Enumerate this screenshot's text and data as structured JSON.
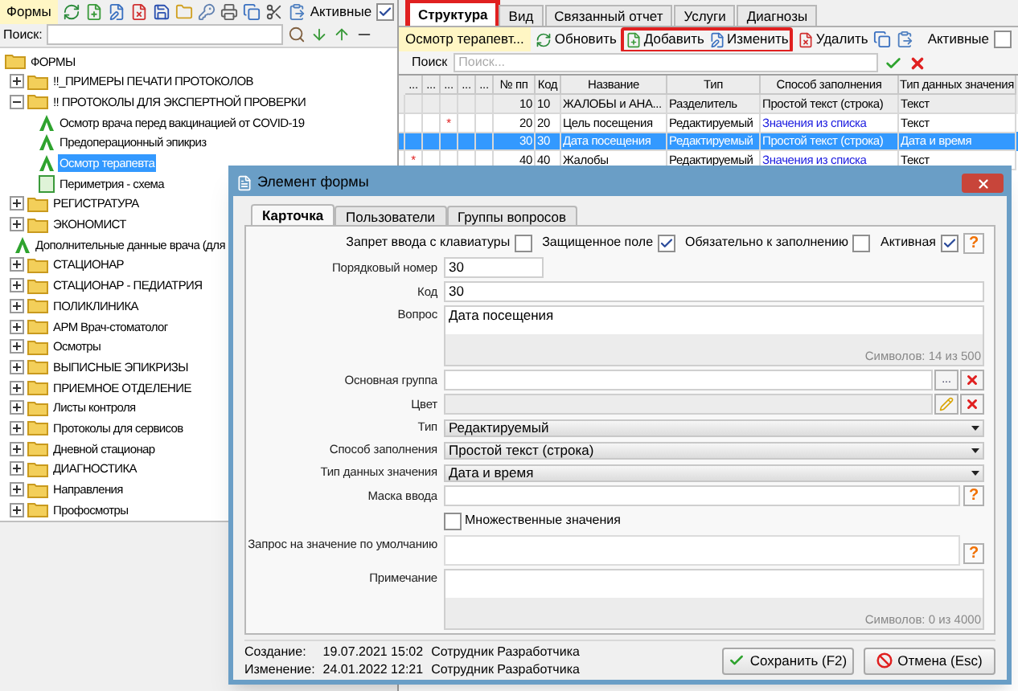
{
  "left_panel": {
    "title": "Формы",
    "active_label": "Активные",
    "active_checked": true,
    "search_label": "Поиск:",
    "tree": [
      {
        "label": "ФОРМЫ",
        "kind": "root",
        "selected": false,
        "children": [
          {
            "label": "!!_ПРИМЕРЫ ПЕЧАТИ ПРОТОКОЛОВ",
            "kind": "folder",
            "expanded": false,
            "selected": false
          },
          {
            "label": "!! ПРОТОКОЛЫ ДЛЯ ЭКСПЕРТНОЙ ПРОВЕРКИ",
            "kind": "folder",
            "expanded": true,
            "selected": false,
            "children": [
              {
                "label": "Осмотр врача перед вакцинацией от COVID-19",
                "kind": "form",
                "selected": false
              },
              {
                "label": "Предоперационный эпикриз",
                "kind": "form",
                "selected": false
              },
              {
                "label": "Осмотр терапевта",
                "kind": "form",
                "selected": true
              },
              {
                "label": "Периметрия - схема",
                "kind": "scheme",
                "selected": false
              }
            ]
          },
          {
            "label": "РЕГИСТРАТУРА",
            "kind": "folder",
            "expanded": false,
            "selected": false
          },
          {
            "label": "ЭКОНОМИСТ",
            "kind": "folder",
            "expanded": false,
            "selected": false
          },
          {
            "label": "Дополнительные данные врача (для",
            "kind": "form",
            "selected": false
          },
          {
            "label": "СТАЦИОНАР",
            "kind": "folder",
            "expanded": false,
            "selected": false
          },
          {
            "label": "СТАЦИОНАР - ПЕДИАТРИЯ",
            "kind": "folder",
            "expanded": false,
            "selected": false
          },
          {
            "label": "ПОЛИКЛИНИКА",
            "kind": "folder",
            "expanded": false,
            "selected": false
          },
          {
            "label": "АРМ Врач-стоматолог",
            "kind": "folder",
            "expanded": false,
            "selected": false
          },
          {
            "label": "Осмотры",
            "kind": "folder",
            "expanded": false,
            "selected": false
          },
          {
            "label": "ВЫПИСНЫЕ ЭПИКРИЗЫ",
            "kind": "folder",
            "expanded": false,
            "selected": false
          },
          {
            "label": "ПРИЕМНОЕ ОТДЕЛЕНИЕ",
            "kind": "folder",
            "expanded": false,
            "selected": false
          },
          {
            "label": "Листы контроля",
            "kind": "folder",
            "expanded": false,
            "selected": false
          },
          {
            "label": "Протоколы для сервисов",
            "kind": "folder",
            "expanded": false,
            "selected": false
          },
          {
            "label": "Дневной стационар",
            "kind": "folder",
            "expanded": false,
            "selected": false
          },
          {
            "label": "ДИАГНОСТИКА",
            "kind": "folder",
            "expanded": false,
            "selected": false
          },
          {
            "label": "Направления",
            "kind": "folder",
            "expanded": false,
            "selected": false
          },
          {
            "label": "Профосмотры",
            "kind": "folder",
            "expanded": false,
            "selected": false
          }
        ]
      }
    ]
  },
  "right_panel": {
    "tabs": [
      {
        "label": "Структура",
        "selected": true
      },
      {
        "label": "Вид",
        "selected": false
      },
      {
        "label": "Связанный отчет",
        "selected": false
      },
      {
        "label": "Услуги",
        "selected": false
      },
      {
        "label": "Диагнозы",
        "selected": false
      }
    ],
    "form_name": "Осмотр терапевт...",
    "refresh": "Обновить",
    "add": "Добавить",
    "edit": "Изменить",
    "delete": "Удалить",
    "active_label": "Активные",
    "active_checked": false,
    "search_label": "Поиск",
    "search_placeholder": "Поиск...",
    "table": {
      "columns": [
        "...",
        "...",
        "...",
        "...",
        "...",
        "№ пп",
        "Код",
        "Название",
        "Тип",
        "Способ заполнения",
        "Тип данных значения"
      ],
      "rows": [
        {
          "selected": false,
          "kind": "separator",
          "cells": [
            "",
            "",
            "",
            "",
            "",
            "10",
            "10",
            "ЖАЛОБЫ и АНА...",
            "Разделитель",
            "Простой текст (строка)",
            "Текст"
          ]
        },
        {
          "selected": false,
          "kind": "item",
          "cells": [
            "",
            "",
            "*",
            "",
            "",
            "20",
            "20",
            "Цель посещения",
            "Редактируемый",
            "Значения из списка",
            "Текст"
          ]
        },
        {
          "selected": true,
          "kind": "item",
          "cells": [
            "",
            "",
            "",
            "",
            "",
            "30",
            "30",
            "Дата посещения",
            "Редактируемый",
            "Простой текст (строка)",
            "Дата и время"
          ]
        },
        {
          "selected": false,
          "kind": "item",
          "cells": [
            "*",
            "",
            "",
            "",
            "",
            "40",
            "40",
            "Жалобы",
            "Редактируемый",
            "Значения из списка",
            "Текст"
          ]
        }
      ]
    }
  },
  "dialog": {
    "title": "Элемент формы",
    "tabs": [
      {
        "label": "Карточка",
        "selected": true
      },
      {
        "label": "Пользователи",
        "selected": false
      },
      {
        "label": "Группы вопросов",
        "selected": false
      }
    ],
    "flags": [
      {
        "label": "Запрет ввода с клавиатуры",
        "checked": false
      },
      {
        "label": "Защищенное поле",
        "checked": true
      },
      {
        "label": "Обязательно к заполнению",
        "checked": false
      },
      {
        "label": "Активная",
        "checked": true
      }
    ],
    "help": "?",
    "fields": [
      {
        "kind": "short",
        "label": "Порядковый номер",
        "value": "30"
      },
      {
        "kind": "text",
        "label": "Код",
        "value": "30"
      },
      {
        "kind": "memo",
        "label": "Вопрос",
        "value": "Дата посещения",
        "counter": "Символов: 14 из 500"
      },
      {
        "kind": "lookup",
        "label": "Основная группа",
        "button": "..."
      },
      {
        "kind": "color",
        "label": "Цвет"
      },
      {
        "kind": "select",
        "label": "Тип",
        "value": "Редактируемый"
      },
      {
        "kind": "select",
        "label": "Способ заполнения",
        "value": "Простой текст (строка)"
      },
      {
        "kind": "select",
        "label": "Тип данных значения",
        "value": "Дата и время"
      },
      {
        "kind": "mask",
        "label": "Маска ввода",
        "help": "?"
      },
      {
        "kind": "checkbox",
        "label": "Множественные значения",
        "checked": false
      },
      {
        "kind": "query",
        "label": "Запрос на значение по умолчанию",
        "help": "?"
      },
      {
        "kind": "memo",
        "label": "Примечание",
        "counter": "Символов: 0 из 4000"
      }
    ],
    "created_label": "Создание:",
    "created": "19.07.2021 15:02",
    "created_by": "Сотрудник Разработчика",
    "modified_label": "Изменение:",
    "modified": "24.01.2022 12:21",
    "modified_by": "Сотрудник Разработчика",
    "save": "Сохранить (F2)",
    "cancel": "Отмена (Esc)"
  }
}
